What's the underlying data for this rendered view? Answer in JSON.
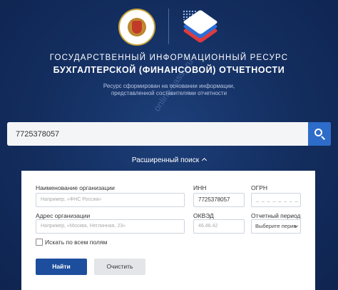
{
  "header": {
    "title_line1": "ГОСУДАРСТВЕННЫЙ ИНФОРМАЦИОННЫЙ РЕСУРС",
    "title_line2": "БУХГАЛТЕРСКОЙ (ФИНАНСОВОЙ) ОТЧЕТНОСТИ",
    "subtitle_line1": "Ресурс сформирован на основании информации,",
    "subtitle_line2": "представленной составителями отчетности"
  },
  "watermark": "online-kassy.ru",
  "search": {
    "value": "7725378057"
  },
  "advanced_toggle_label": "Расширенный поиск",
  "advanced": {
    "org_name_label": "Наименование организации",
    "org_name_placeholder": "Например, «ФНС России»",
    "inn_label": "ИНН",
    "inn_value": "7725378057",
    "ogrn_label": "ОГРН",
    "ogrn_placeholder": "_ _ _ _ _ _ _ _ _",
    "address_label": "Адрес организации",
    "address_placeholder": "Например, «Москва, Неглинная, 23»",
    "okved_label": "ОКВЭД",
    "okved_placeholder": "46.48.42",
    "period_label": "Отчетный период",
    "period_value": "Выберите перио",
    "all_fields_label": "Искать по всем полям",
    "find_button": "Найти",
    "clear_button": "Очистить"
  },
  "colors": {
    "background": "#132d5e",
    "primary_button": "#1d4e9e",
    "search_button": "#2d6cc9"
  }
}
